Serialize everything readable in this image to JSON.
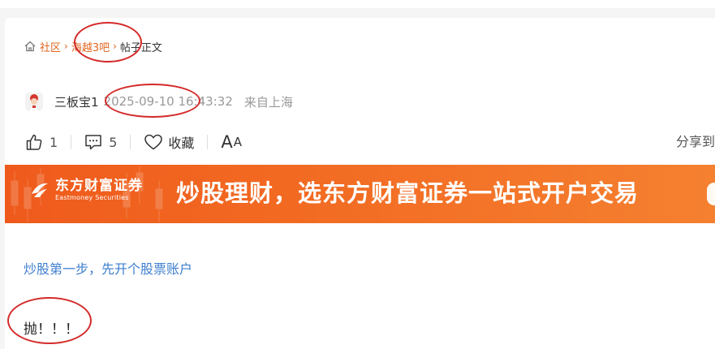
{
  "breadcrumb": {
    "home_icon": "home-icon",
    "items": [
      "社区",
      "海越3吧"
    ],
    "current": "帖子正文"
  },
  "author": {
    "name": "三板宝1",
    "post_time": "2025-09-10 16:43:32",
    "location": "来自上海"
  },
  "actions": {
    "like_count": "1",
    "comment_count": "5",
    "favorite_label": "收藏",
    "font_size_label_big": "A",
    "font_size_label_small": "A",
    "share_label": "分享到"
  },
  "banner": {
    "brand_cn": "东方财富证券",
    "brand_en": "Eastmoney Securities",
    "slogan": "炒股理财，选东方财富证券一站式开户交易"
  },
  "promo_link": "炒股第一步，先开个股票账户",
  "post_body": "抛！！！",
  "colors": {
    "accent": "#e0651f",
    "banner": "#f26a22",
    "link": "#3d7ecf",
    "annotation": "#d42a2a"
  }
}
